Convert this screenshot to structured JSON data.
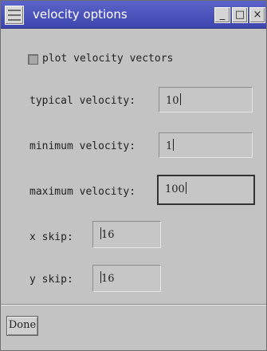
{
  "window": {
    "title": "velocity options",
    "minimize_label": "_",
    "maximize_label": "□",
    "close_label": "×"
  },
  "plot_vectors": {
    "label": "plot velocity vectors",
    "checked": false
  },
  "fields": {
    "typical": {
      "label": "typical velocity:",
      "value": "10"
    },
    "minimum": {
      "label": "minimum velocity:",
      "value": "1"
    },
    "maximum": {
      "label": "maximum velocity:",
      "value": "100"
    },
    "x_skip": {
      "label": "x skip:",
      "value": "16"
    },
    "y_skip": {
      "label": "y skip:",
      "value": "16"
    }
  },
  "done_label": "Done",
  "colors": {
    "titlebar": "#4a52ba",
    "window_bg": "#c3c3c3"
  }
}
